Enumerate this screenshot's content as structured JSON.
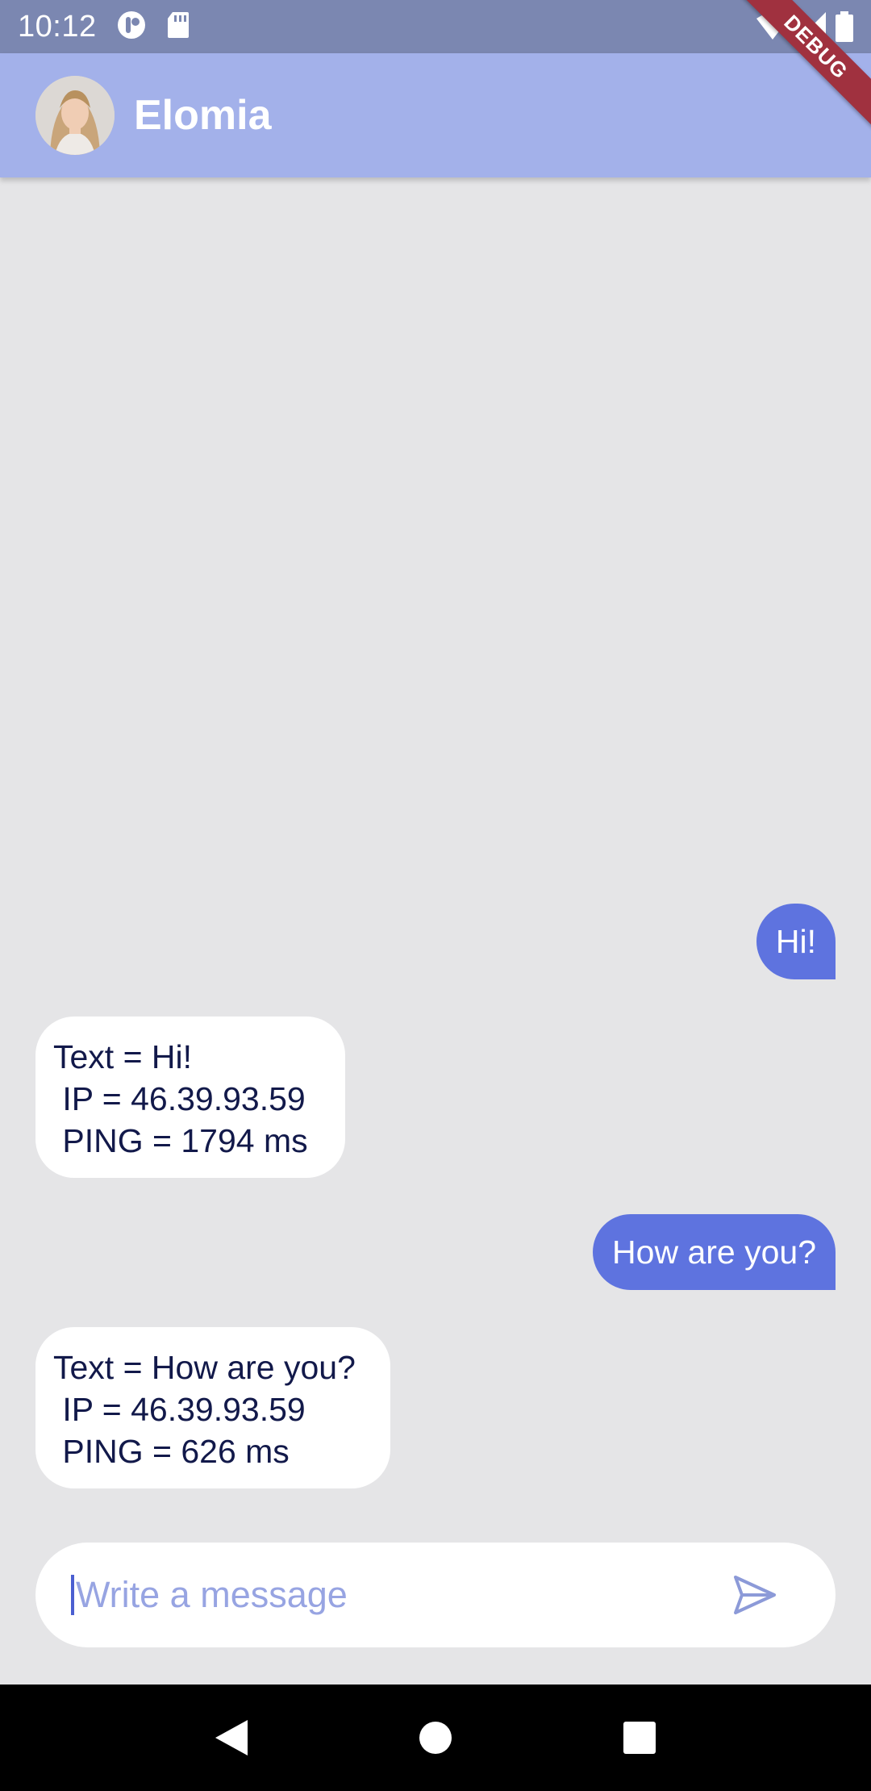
{
  "status_bar": {
    "time": "10:12",
    "icons": [
      "app-notification-icon",
      "sd-card-icon",
      "wifi-icon",
      "signal-icon",
      "battery-icon"
    ]
  },
  "debug_banner": "DEBUG",
  "app_bar": {
    "title": "Elomia",
    "avatar": "profile-photo"
  },
  "messages": [
    {
      "direction": "outgoing",
      "text": "Hi!"
    },
    {
      "direction": "incoming",
      "lines": [
        "Text = Hi!",
        " IP = 46.39.93.59",
        " PING = 1794 ms"
      ]
    },
    {
      "direction": "outgoing",
      "text": "How are you?"
    },
    {
      "direction": "incoming",
      "lines": [
        "Text = How are you?",
        " IP = 46.39.93.59",
        " PING = 626 ms"
      ]
    }
  ],
  "composer": {
    "placeholder": "Write a message",
    "value": "",
    "send_icon": "send-icon"
  },
  "nav": [
    "back-icon",
    "home-icon",
    "recents-icon"
  ],
  "colors": {
    "status_bar": "#7b87b1",
    "app_bar": "#a3b1ea",
    "background": "#e5e5e7",
    "outgoing_bubble": "#5e73df",
    "incoming_text": "#12194a",
    "placeholder": "#97a4e2",
    "debug": "#a0313f"
  }
}
